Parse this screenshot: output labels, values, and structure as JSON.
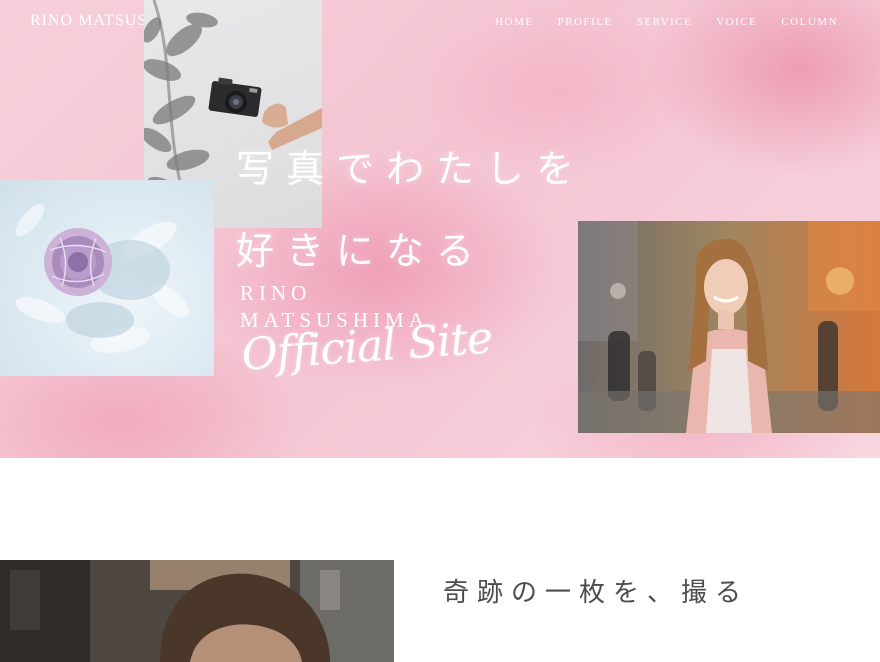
{
  "site": {
    "brand": "RINO MATSUSHIMA"
  },
  "nav": {
    "items": [
      "HOME",
      "PROFILE",
      "SERVICE",
      "VOICE",
      "COLUMN"
    ]
  },
  "hero": {
    "title_line1": "写真でわたしを",
    "title_line2": "好きになる",
    "name_line1": "RINO",
    "name_line2": "MATSUSHIMA",
    "script": "Official Site"
  },
  "section2": {
    "heading": "奇跡の一枚を、撮る"
  },
  "colors": {
    "hero_pink": "#f4c4d1",
    "text_white": "#ffffff",
    "heading_gray": "#4d4d4d"
  }
}
